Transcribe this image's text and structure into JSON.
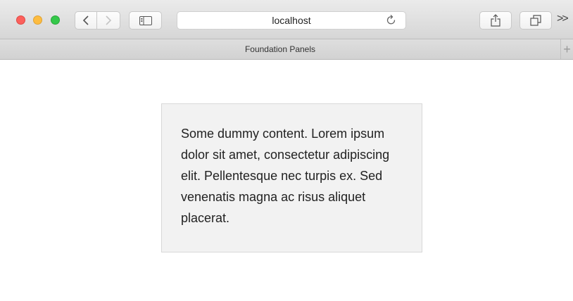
{
  "browser": {
    "url": "localhost",
    "overflow_label": ">>",
    "colors": {
      "close": "#fc605c",
      "minimize": "#fdbc40",
      "zoom": "#34c84a"
    },
    "icons": [
      "chevron-left-icon",
      "chevron-right-icon",
      "sidebar-icon",
      "reload-icon",
      "share-icon",
      "tabs-icon"
    ]
  },
  "tab": {
    "title": "Foundation Panels",
    "new_tab_label": "+"
  },
  "page": {
    "panel_text": "Some dummy content. Lorem ipsum dolor sit amet, consectetur adipiscing elit. Pellentesque nec turpis ex. Sed venenatis magna ac risus aliquet placerat."
  }
}
